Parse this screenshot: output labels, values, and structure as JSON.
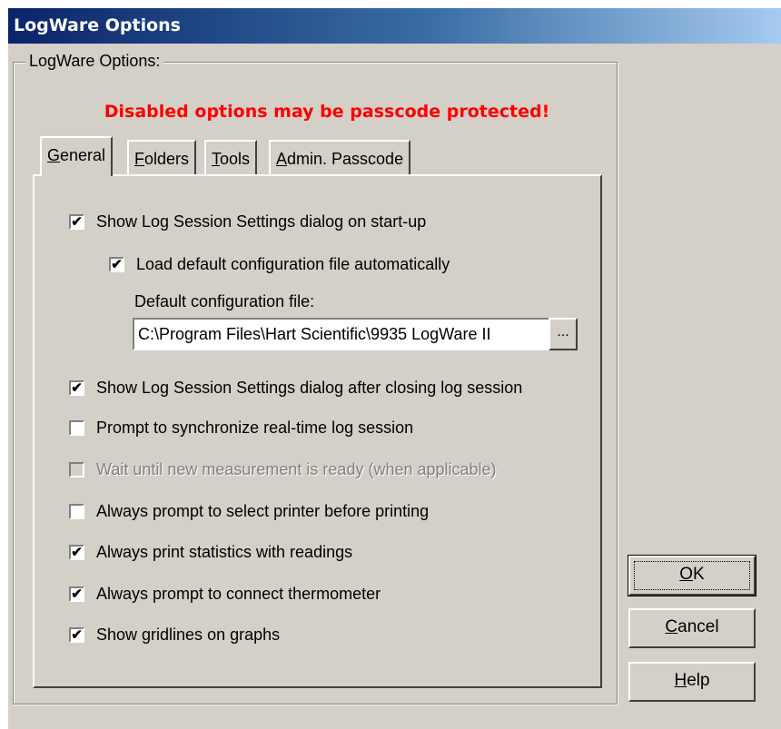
{
  "window": {
    "title": "LogWare Options"
  },
  "group": {
    "label": "LogWare Options:"
  },
  "warning": "Disabled options may be passcode protected!",
  "tabs": [
    {
      "label": "General",
      "access_key": "G",
      "rest": "eneral"
    },
    {
      "label": "Folders",
      "access_key": "F",
      "rest": "olders"
    },
    {
      "label": "Tools",
      "access_key": "T",
      "rest": "ools"
    },
    {
      "label": "Admin. Passcode",
      "access_key": "A",
      "rest": "dmin. Passcode"
    }
  ],
  "active_tab": "General",
  "options": [
    {
      "label": "Show Log Session Settings dialog on start-up",
      "checked": true,
      "enabled": true
    },
    {
      "label": "Load default configuration file automatically",
      "checked": true,
      "enabled": true
    },
    {
      "label": "Show Log Session Settings dialog after closing log session",
      "checked": true,
      "enabled": true
    },
    {
      "label": "Prompt to synchronize real-time log session",
      "checked": false,
      "enabled": true
    },
    {
      "label": "Wait until new measurement is ready (when applicable)",
      "checked": false,
      "enabled": false
    },
    {
      "label": "Always prompt to select printer before printing",
      "checked": false,
      "enabled": true
    },
    {
      "label": "Always print statistics with readings",
      "checked": true,
      "enabled": true
    },
    {
      "label": "Always prompt to connect thermometer",
      "checked": true,
      "enabled": true
    },
    {
      "label": "Show gridlines on graphs",
      "checked": true,
      "enabled": true
    }
  ],
  "config_file": {
    "label": "Default configuration file:",
    "value": "C:\\Program Files\\Hart Scientific\\9935 LogWare II",
    "browse_label": "..."
  },
  "buttons": {
    "ok": {
      "key": "O",
      "rest": "K"
    },
    "cancel": {
      "key": "C",
      "rest": "ancel"
    },
    "help": {
      "key": "H",
      "rest": "elp"
    }
  },
  "check_glyph": "✔"
}
